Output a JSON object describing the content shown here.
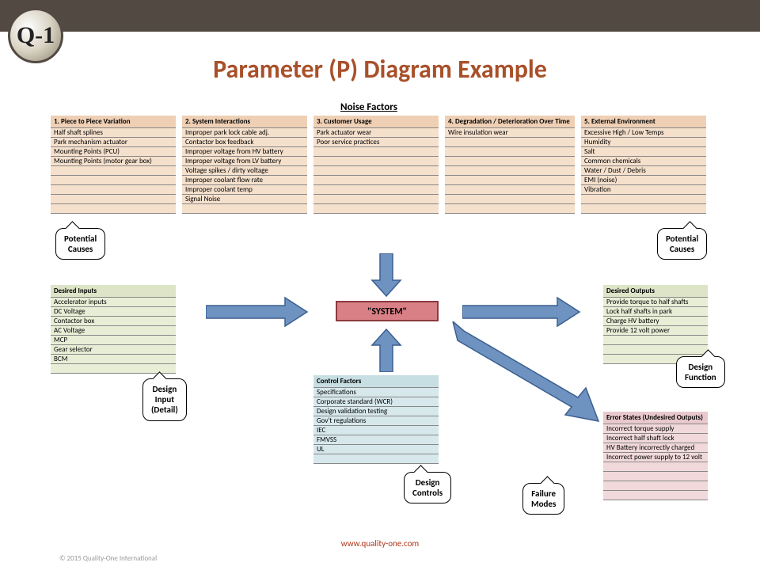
{
  "logo_text": "Q-1",
  "title": "Parameter (P) Diagram Example",
  "noise_section": "Noise Factors",
  "noise": [
    {
      "hdr": "1. Piece to Piece Variation",
      "rows": [
        "Half shaft splines",
        "Park mechanism actuator",
        "Mounting Points (PCU)",
        "Mounting Points (motor gear box)",
        "",
        "",
        "",
        "",
        ""
      ]
    },
    {
      "hdr": "2. System Interactions",
      "rows": [
        "Improper park lock cable adj.",
        "Contactor box feedback",
        "Improper voltage from HV battery",
        "Improper voltage from LV battery",
        "Voltage spikes / dirty voltage",
        "Improper coolant flow rate",
        "Improper coolant temp",
        "Signal Noise",
        ""
      ]
    },
    {
      "hdr": "3. Customer Usage",
      "rows": [
        "Park actuator wear",
        "Poor service practices",
        "",
        "",
        "",
        "",
        "",
        "",
        ""
      ]
    },
    {
      "hdr": "4. Degradation / Deterioration Over Time",
      "rows": [
        "Wire insulation wear",
        "",
        "",
        "",
        "",
        "",
        "",
        "",
        ""
      ]
    },
    {
      "hdr": "5. External Environment",
      "rows": [
        "Excessive High / Low Temps",
        "Humidity",
        "Salt",
        "Common chemicals",
        "Water / Dust / Debris",
        "EMI (noise)",
        "Vibration",
        "",
        ""
      ]
    }
  ],
  "inputs": {
    "hdr": "Desired Inputs",
    "rows": [
      "Accelerator inputs",
      "DC Voltage",
      "Contactor box",
      "AC Voltage",
      "MCP",
      "Gear selector",
      "BCM",
      ""
    ]
  },
  "outputs": {
    "hdr": "Desired Outputs",
    "rows": [
      "Provide torque to half shafts",
      "Lock half shafts in park",
      "Charge HV battery",
      "Provide 12 volt power",
      "",
      "",
      ""
    ]
  },
  "control": {
    "hdr": "Control Factors",
    "rows": [
      "Specifications",
      "Corporate standard (WCR)",
      "Design validation testing",
      "Gov't regulations",
      "IEC",
      "FMVSS",
      "UL",
      ""
    ]
  },
  "error": {
    "hdr": "Error States (Undesired Outputs)",
    "rows": [
      "Incorrect torque supply",
      "Incorrect half shaft lock",
      "HV Battery incorrectly charged",
      "Incorrect power supply to 12 volt",
      "",
      "",
      "",
      ""
    ]
  },
  "system": "\"SYSTEM\"",
  "callouts": {
    "potential_causes": "Potential\nCauses",
    "design_input": "Design\nInput\n(Detail)",
    "design_controls": "Design\nControls",
    "design_function": "Design\nFunction",
    "failure_modes": "Failure\nModes"
  },
  "url": "www.quality-one.com",
  "copyright": "© 2015 Quality-One International"
}
